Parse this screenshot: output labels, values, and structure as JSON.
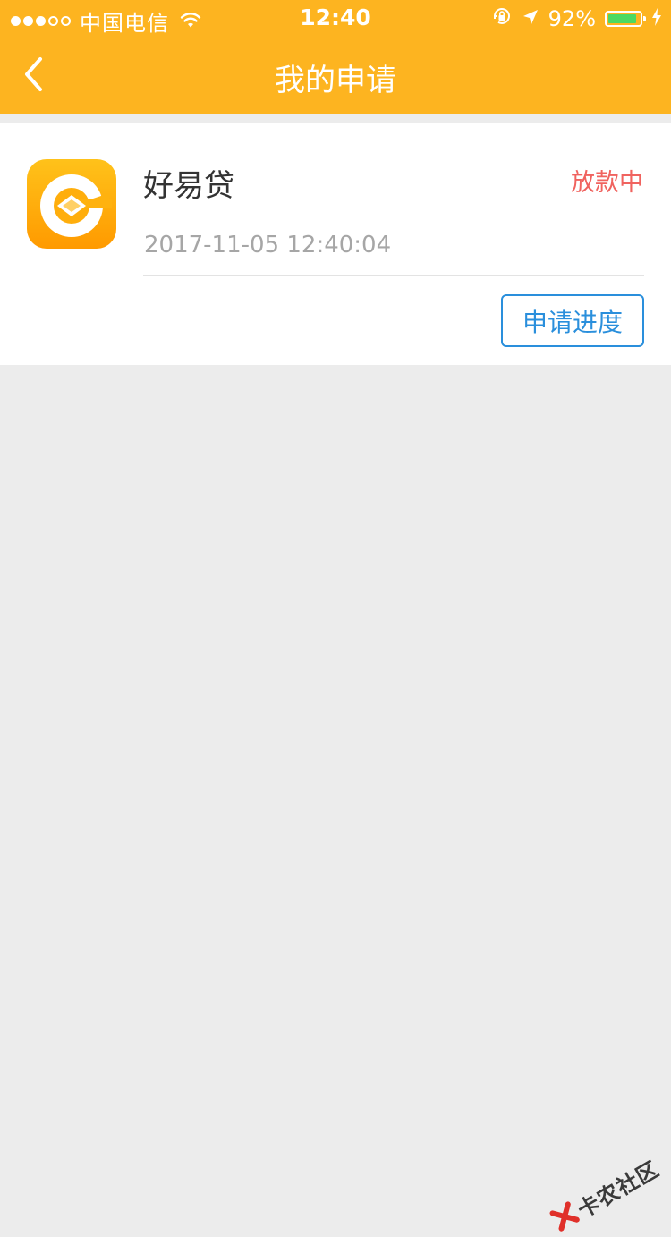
{
  "status_bar": {
    "carrier": "中国电信",
    "time": "12:40",
    "battery_percent": "92%",
    "battery_level": 0.92,
    "signal_bars": 3,
    "signal_total": 5
  },
  "nav": {
    "title": "我的申请",
    "back_icon": "chevron-left-icon"
  },
  "application": {
    "app_name": "好易贷",
    "status": "放款中",
    "datetime": "2017-11-05 12:40:04",
    "progress_button": "申请进度"
  },
  "watermark": {
    "text": "卡农社区"
  },
  "colors": {
    "header_bg": "#fdb420",
    "status_red": "#f0635f",
    "button_blue": "#2a8fdc",
    "page_bg": "#ececec"
  }
}
